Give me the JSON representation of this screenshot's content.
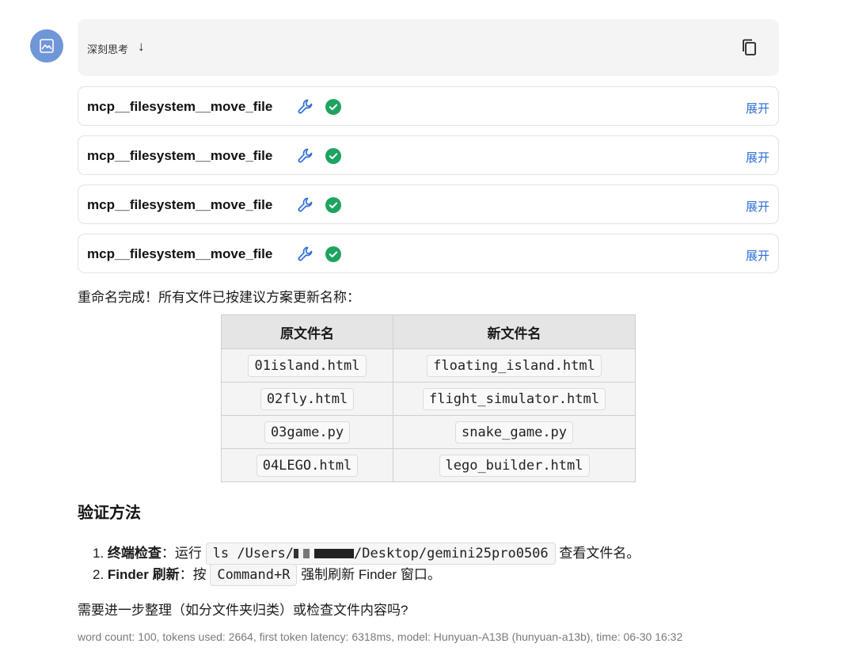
{
  "thinking": {
    "label": "深刻思考",
    "arrow": "↓"
  },
  "tool_calls": [
    {
      "name": "mcp__filesystem__move_file",
      "expand_label": "展开"
    },
    {
      "name": "mcp__filesystem__move_file",
      "expand_label": "展开"
    },
    {
      "name": "mcp__filesystem__move_file",
      "expand_label": "展开"
    },
    {
      "name": "mcp__filesystem__move_file",
      "expand_label": "展开"
    }
  ],
  "summary": "重命名完成！所有文件已按建议方案更新名称：",
  "table": {
    "headers": [
      "原文件名",
      "新文件名"
    ],
    "rows": [
      [
        "01island.html",
        "floating_island.html"
      ],
      [
        "02fly.html",
        "flight_simulator.html"
      ],
      [
        "03game.py",
        "snake_game.py"
      ],
      [
        "04LEGO.html",
        "lego_builder.html"
      ]
    ]
  },
  "verify": {
    "heading": "验证方法",
    "steps": [
      {
        "num": "1.",
        "title": "终端检查",
        "sep": "：",
        "before": "运行",
        "code_a": "ls /Users/",
        "code_b": "/Desktop/gemini25pro0506",
        "after": "查看文件名。"
      },
      {
        "num": "2.",
        "title": "Finder 刷新",
        "sep": "：",
        "before": "按",
        "code": "Command+R",
        "after": "强制刷新 Finder 窗口。"
      }
    ]
  },
  "question": "需要进一步整理（如分文件夹归类）或检查文件内容吗?",
  "meta": "word count: 100, tokens used: 2664, first token latency: 6318ms, model: Hunyuan-A13B (hunyuan-a13b), time: 06-30 16:32",
  "colors": {
    "accent": "#2f6fd6",
    "success": "#1fa360",
    "avatar": "#6f96d6"
  },
  "icons": {
    "avatar": "image-icon",
    "copy": "copy-icon",
    "tool": "wrench-icon",
    "status": "check-circle-icon"
  }
}
